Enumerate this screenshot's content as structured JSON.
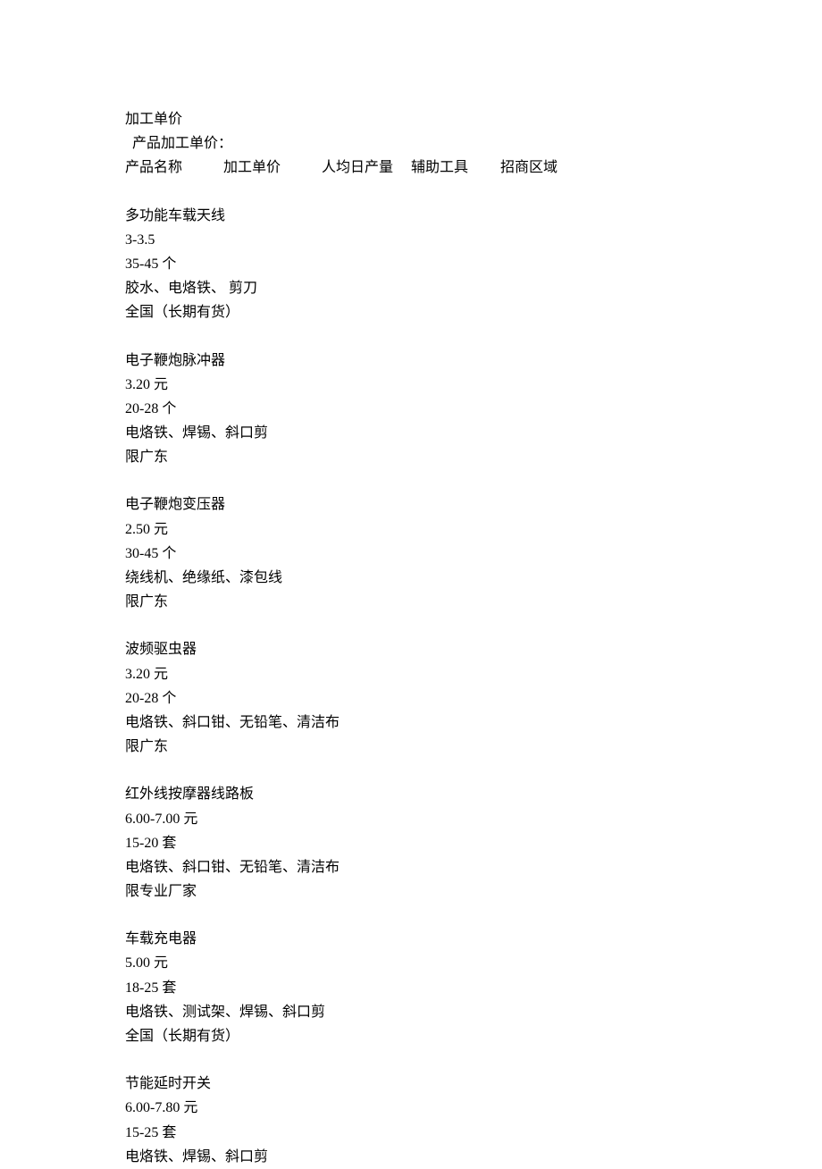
{
  "title": "加工单价",
  "subtitle": "产品加工单价：",
  "headers": {
    "name": "产品名称",
    "price": "加工单价",
    "output": "人均日产量",
    "tools": "辅助工具",
    "region": "招商区域"
  },
  "products": [
    {
      "name": "多功能车载天线",
      "price": "3-3.5",
      "output": "35-45 个",
      "tools": "胶水、电烙铁、   剪刀",
      "region": "全国（长期有货）"
    },
    {
      "name": "电子鞭炮脉冲器",
      "price": "3.20 元",
      "output": "20-28 个",
      "tools": "电烙铁、焊锡、斜口剪",
      "region": "限广东"
    },
    {
      "name": "电子鞭炮变压器",
      "price": "2.50 元",
      "output": "30-45 个",
      "tools": "绕线机、绝缘纸、漆包线",
      "region": "限广东"
    },
    {
      "name": "波频驱虫器",
      "price": "3.20 元",
      "output": "20-28 个",
      "tools": "电烙铁、斜口钳、无铅笔、清洁布",
      "region": "限广东"
    },
    {
      "name": "红外线按摩器线路板",
      "price": "6.00-7.00 元",
      "output": "15-20 套",
      "tools": "电烙铁、斜口钳、无铅笔、清洁布",
      "region": "限专业厂家"
    },
    {
      "name": "车载充电器",
      "price": "5.00 元",
      "output": "18-25 套",
      "tools": "电烙铁、测试架、焊锡、斜口剪",
      "region": "全国（长期有货）"
    },
    {
      "name": "节能延时开关",
      "price": "6.00-7.80 元",
      "output": "15-25 套",
      "tools": "电烙铁、焊锡、斜口剪",
      "region": ""
    }
  ]
}
